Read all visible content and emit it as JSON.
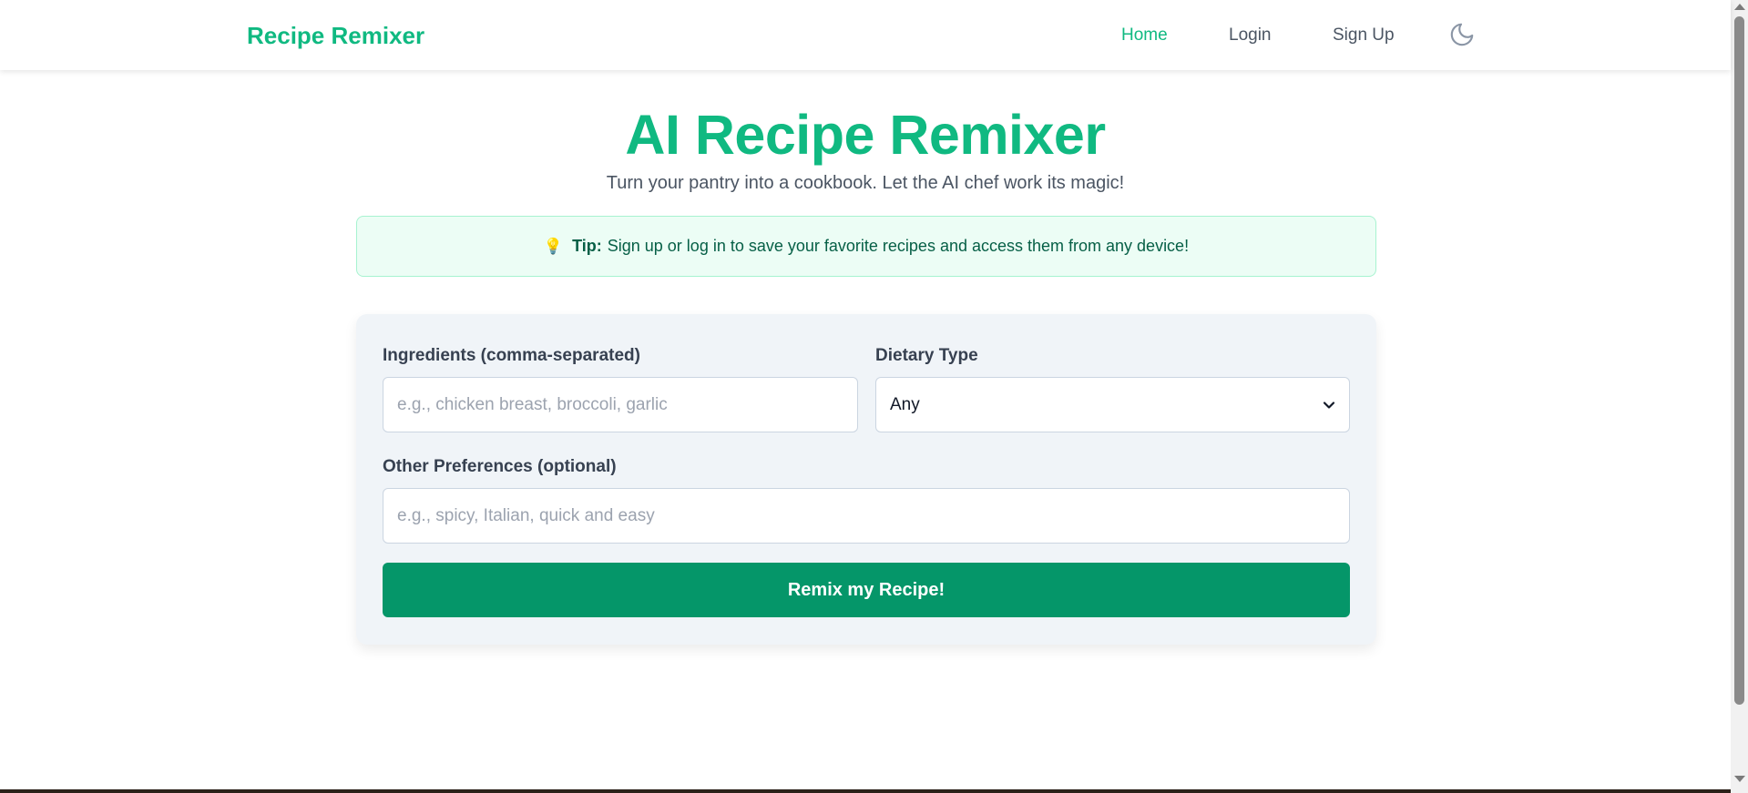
{
  "header": {
    "brand": "Recipe Remixer",
    "nav": [
      {
        "label": "Home",
        "active": true
      },
      {
        "label": "Login",
        "active": false
      },
      {
        "label": "Sign Up",
        "active": false
      }
    ],
    "theme_toggle_icon": "moon-icon"
  },
  "hero": {
    "title": "AI Recipe Remixer",
    "subtitle": "Turn your pantry into a cookbook. Let the AI chef work its magic!"
  },
  "tip": {
    "icon": "lightbulb-icon",
    "label": "Tip:",
    "text": "Sign up or log in to save your favorite recipes and access them from any device!"
  },
  "form": {
    "ingredients": {
      "label": "Ingredients (comma-separated)",
      "value": "",
      "placeholder": "e.g., chicken breast, broccoli, garlic"
    },
    "dietary": {
      "label": "Dietary Type",
      "selected": "Any"
    },
    "preferences": {
      "label": "Other Preferences (optional)",
      "value": "",
      "placeholder": "e.g., spicy, Italian, quick and easy"
    },
    "submit_label": "Remix my Recipe!"
  },
  "colors": {
    "brand": "#10b981",
    "button": "#059669",
    "tip_background": "#ecfdf5",
    "card_background": "#f0f4f8"
  }
}
